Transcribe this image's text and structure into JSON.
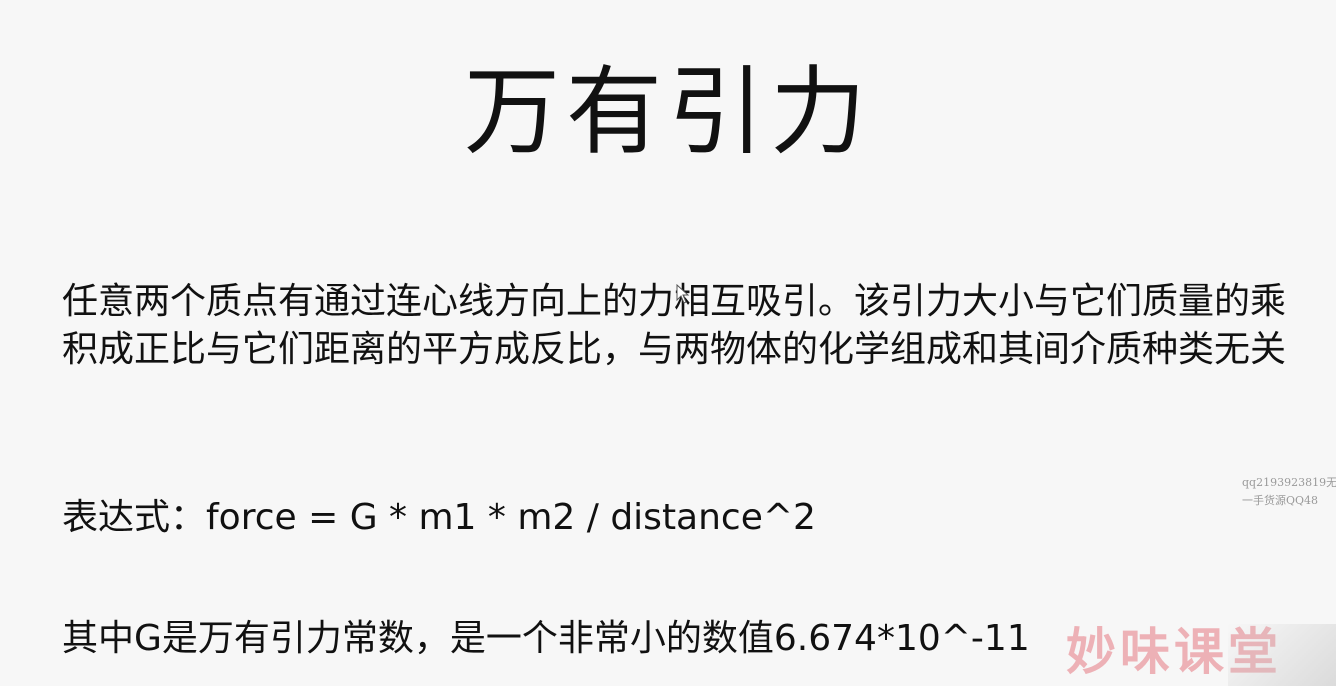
{
  "slide": {
    "title": "万有引力",
    "paragraph": "任意两个质点有通过连心线方向上的力相互吸引。该引力大小与它们质量的乘积成正比与它们距离的平方成反比，与两物体的化学组成和其间介质种类无关",
    "formula": "表达式：force = G * m1 * m2 / distance^2",
    "constant_note": "其中G是万有引力常数，是一个非常小的数值6.674*10^-11"
  },
  "watermark": {
    "line1": "qq2193923819无",
    "line2": "一手货源QQ48",
    "logo": "妙味课堂"
  },
  "colors": {
    "background": "#f7f7f7",
    "text": "#111111",
    "logo": "#e6788255"
  }
}
